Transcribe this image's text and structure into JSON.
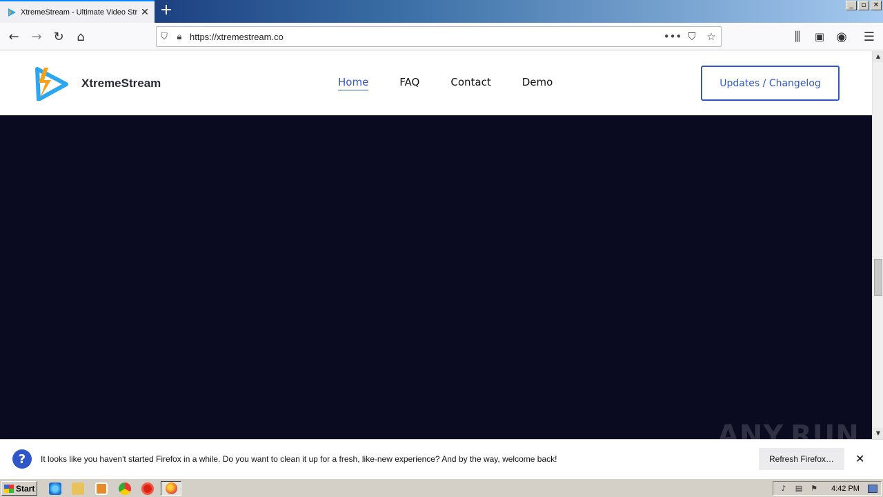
{
  "browser": {
    "tab_title": "XtremeStream - Ultimate Video Str",
    "tab_close": "✕",
    "new_tab": "+",
    "url": "https://xtremestream.co",
    "window_controls": [
      "_",
      "▫",
      "✕"
    ]
  },
  "site": {
    "brand": "XtremeStream",
    "nav": [
      "Home",
      "FAQ",
      "Contact",
      "Demo"
    ],
    "active_nav": "Home",
    "cta": "Updates / Changelog",
    "hero_color": "#0a0a21",
    "accent_color": "#2f57c9"
  },
  "notification": {
    "message": "It looks like you haven't started Firefox in a while. Do you want to clean it up for a fresh, like-new experience? And by the way, welcome back!",
    "button": "Refresh Firefox…",
    "close": "✕"
  },
  "watermark": "ANY.RUN",
  "taskbar": {
    "start": "Start",
    "clock": "4:42 PM"
  }
}
